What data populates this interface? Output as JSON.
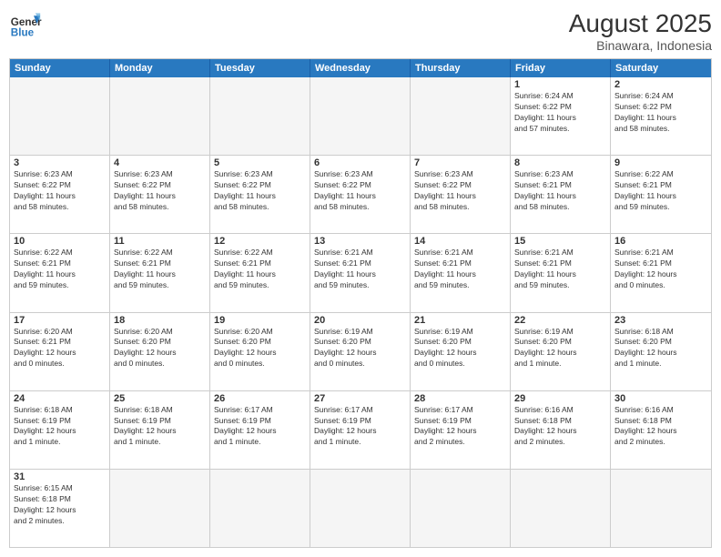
{
  "header": {
    "logo_general": "General",
    "logo_blue": "Blue",
    "month_year": "August 2025",
    "location": "Binawara, Indonesia"
  },
  "days_of_week": [
    "Sunday",
    "Monday",
    "Tuesday",
    "Wednesday",
    "Thursday",
    "Friday",
    "Saturday"
  ],
  "weeks": [
    [
      {
        "day": "",
        "info": ""
      },
      {
        "day": "",
        "info": ""
      },
      {
        "day": "",
        "info": ""
      },
      {
        "day": "",
        "info": ""
      },
      {
        "day": "",
        "info": ""
      },
      {
        "day": "1",
        "info": "Sunrise: 6:24 AM\nSunset: 6:22 PM\nDaylight: 11 hours\nand 57 minutes."
      },
      {
        "day": "2",
        "info": "Sunrise: 6:24 AM\nSunset: 6:22 PM\nDaylight: 11 hours\nand 58 minutes."
      }
    ],
    [
      {
        "day": "3",
        "info": "Sunrise: 6:23 AM\nSunset: 6:22 PM\nDaylight: 11 hours\nand 58 minutes."
      },
      {
        "day": "4",
        "info": "Sunrise: 6:23 AM\nSunset: 6:22 PM\nDaylight: 11 hours\nand 58 minutes."
      },
      {
        "day": "5",
        "info": "Sunrise: 6:23 AM\nSunset: 6:22 PM\nDaylight: 11 hours\nand 58 minutes."
      },
      {
        "day": "6",
        "info": "Sunrise: 6:23 AM\nSunset: 6:22 PM\nDaylight: 11 hours\nand 58 minutes."
      },
      {
        "day": "7",
        "info": "Sunrise: 6:23 AM\nSunset: 6:22 PM\nDaylight: 11 hours\nand 58 minutes."
      },
      {
        "day": "8",
        "info": "Sunrise: 6:23 AM\nSunset: 6:21 PM\nDaylight: 11 hours\nand 58 minutes."
      },
      {
        "day": "9",
        "info": "Sunrise: 6:22 AM\nSunset: 6:21 PM\nDaylight: 11 hours\nand 59 minutes."
      }
    ],
    [
      {
        "day": "10",
        "info": "Sunrise: 6:22 AM\nSunset: 6:21 PM\nDaylight: 11 hours\nand 59 minutes."
      },
      {
        "day": "11",
        "info": "Sunrise: 6:22 AM\nSunset: 6:21 PM\nDaylight: 11 hours\nand 59 minutes."
      },
      {
        "day": "12",
        "info": "Sunrise: 6:22 AM\nSunset: 6:21 PM\nDaylight: 11 hours\nand 59 minutes."
      },
      {
        "day": "13",
        "info": "Sunrise: 6:21 AM\nSunset: 6:21 PM\nDaylight: 11 hours\nand 59 minutes."
      },
      {
        "day": "14",
        "info": "Sunrise: 6:21 AM\nSunset: 6:21 PM\nDaylight: 11 hours\nand 59 minutes."
      },
      {
        "day": "15",
        "info": "Sunrise: 6:21 AM\nSunset: 6:21 PM\nDaylight: 11 hours\nand 59 minutes."
      },
      {
        "day": "16",
        "info": "Sunrise: 6:21 AM\nSunset: 6:21 PM\nDaylight: 12 hours\nand 0 minutes."
      }
    ],
    [
      {
        "day": "17",
        "info": "Sunrise: 6:20 AM\nSunset: 6:21 PM\nDaylight: 12 hours\nand 0 minutes."
      },
      {
        "day": "18",
        "info": "Sunrise: 6:20 AM\nSunset: 6:20 PM\nDaylight: 12 hours\nand 0 minutes."
      },
      {
        "day": "19",
        "info": "Sunrise: 6:20 AM\nSunset: 6:20 PM\nDaylight: 12 hours\nand 0 minutes."
      },
      {
        "day": "20",
        "info": "Sunrise: 6:19 AM\nSunset: 6:20 PM\nDaylight: 12 hours\nand 0 minutes."
      },
      {
        "day": "21",
        "info": "Sunrise: 6:19 AM\nSunset: 6:20 PM\nDaylight: 12 hours\nand 0 minutes."
      },
      {
        "day": "22",
        "info": "Sunrise: 6:19 AM\nSunset: 6:20 PM\nDaylight: 12 hours\nand 1 minute."
      },
      {
        "day": "23",
        "info": "Sunrise: 6:18 AM\nSunset: 6:20 PM\nDaylight: 12 hours\nand 1 minute."
      }
    ],
    [
      {
        "day": "24",
        "info": "Sunrise: 6:18 AM\nSunset: 6:19 PM\nDaylight: 12 hours\nand 1 minute."
      },
      {
        "day": "25",
        "info": "Sunrise: 6:18 AM\nSunset: 6:19 PM\nDaylight: 12 hours\nand 1 minute."
      },
      {
        "day": "26",
        "info": "Sunrise: 6:17 AM\nSunset: 6:19 PM\nDaylight: 12 hours\nand 1 minute."
      },
      {
        "day": "27",
        "info": "Sunrise: 6:17 AM\nSunset: 6:19 PM\nDaylight: 12 hours\nand 1 minute."
      },
      {
        "day": "28",
        "info": "Sunrise: 6:17 AM\nSunset: 6:19 PM\nDaylight: 12 hours\nand 2 minutes."
      },
      {
        "day": "29",
        "info": "Sunrise: 6:16 AM\nSunset: 6:18 PM\nDaylight: 12 hours\nand 2 minutes."
      },
      {
        "day": "30",
        "info": "Sunrise: 6:16 AM\nSunset: 6:18 PM\nDaylight: 12 hours\nand 2 minutes."
      }
    ],
    [
      {
        "day": "31",
        "info": "Sunrise: 6:15 AM\nSunset: 6:18 PM\nDaylight: 12 hours\nand 2 minutes."
      },
      {
        "day": "",
        "info": ""
      },
      {
        "day": "",
        "info": ""
      },
      {
        "day": "",
        "info": ""
      },
      {
        "day": "",
        "info": ""
      },
      {
        "day": "",
        "info": ""
      },
      {
        "day": "",
        "info": ""
      }
    ]
  ]
}
